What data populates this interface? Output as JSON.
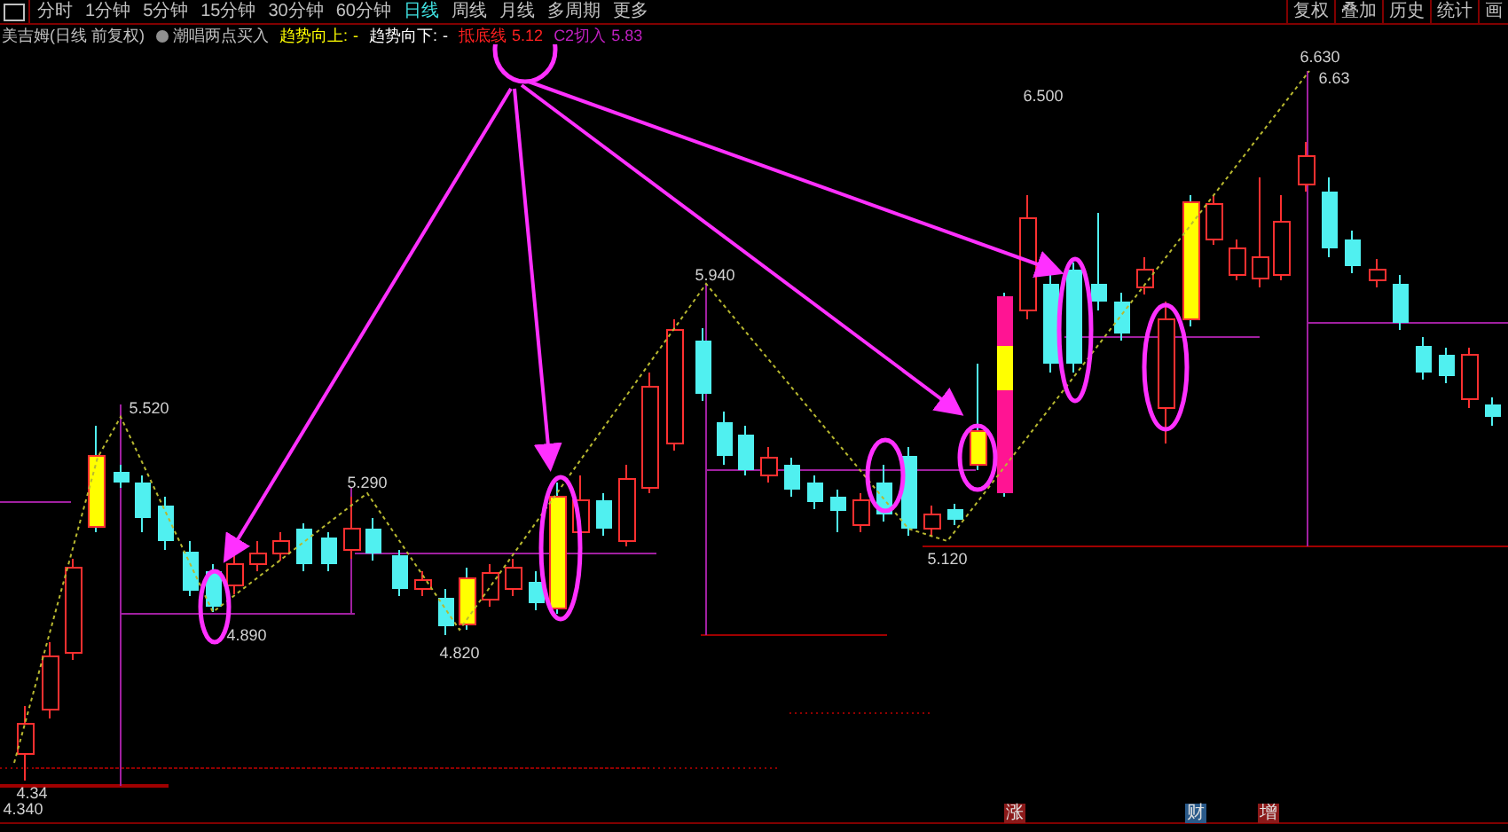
{
  "toolbar": {
    "periods": [
      {
        "label": "分时",
        "selected": false
      },
      {
        "label": "1分钟",
        "selected": false
      },
      {
        "label": "5分钟",
        "selected": false
      },
      {
        "label": "15分钟",
        "selected": false
      },
      {
        "label": "30分钟",
        "selected": false
      },
      {
        "label": "60分钟",
        "selected": false
      },
      {
        "label": "日线",
        "selected": true
      },
      {
        "label": "周线",
        "selected": false
      },
      {
        "label": "月线",
        "selected": false
      },
      {
        "label": "多周期",
        "selected": false
      },
      {
        "label": "更多",
        "selected": false
      }
    ],
    "right_buttons": [
      "复权",
      "叠加",
      "历史",
      "统计",
      "画"
    ]
  },
  "legend": {
    "stock": "美吉姆(日线 前复权)",
    "indicator": "潮唱两点买入",
    "items": [
      {
        "label": "趋势向上:",
        "value": "-",
        "color": "#ffff00"
      },
      {
        "label": "趋势向下:",
        "value": "-",
        "color": "#ffffff"
      },
      {
        "label": "抵底线",
        "value": "5.12",
        "color": "#ff2020"
      },
      {
        "label": "C2切入",
        "value": "5.83",
        "color": "#c020c0"
      }
    ]
  },
  "price_labels": [
    "5.520",
    "5.290",
    "4.890",
    "4.820",
    "5.940",
    "5.120",
    "6.500",
    "6.630",
    "6.63",
    "4.34",
    "4.340"
  ],
  "bottom_markers": [
    {
      "text": "涨",
      "color": "#8b1a1a"
    },
    {
      "text": "财",
      "color": "#2a5a8a"
    },
    {
      "text": "增",
      "color": "#8b1a1a"
    }
  ]
}
